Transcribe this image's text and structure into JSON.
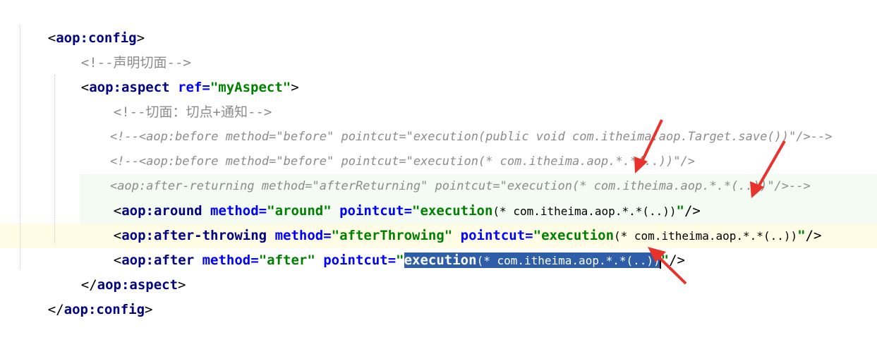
{
  "editor": {
    "lines": {
      "l1": {
        "open": "<",
        "tag": "aop:config",
        "close": ">"
      },
      "l2": {
        "comment": "<!--声明切面-->"
      },
      "l3": {
        "open": "<",
        "tag": "aop:aspect",
        "attr1": " ref=",
        "val1": "\"myAspect\"",
        "close": ">"
      },
      "l4": {
        "comment": "<!--切面：切点+通知-->"
      },
      "l5": {
        "comment": "<!--<aop:before method=\"before\" pointcut=\"execution(public void com.itheima.aop.Target.save())\"/>-->"
      },
      "l6": {
        "comment": "<!--<aop:before method=\"before\" pointcut=\"execution(* com.itheima.aop.*.*(..))\"/>"
      },
      "l7": {
        "comment": "<aop:after-returning method=\"afterReturning\" pointcut=\"execution(* com.itheima.aop.*.*(..))\"/>-->"
      },
      "l8": {
        "open": "<",
        "tag": "aop:around",
        "attr1": " method=",
        "val1": "\"around\"",
        "attr2": " pointcut=",
        "val2a": "\"execution",
        "val2b": "(* com.itheima.aop.*.*(..))",
        "val2c": "\"",
        "close": "/>"
      },
      "l9": {
        "open": "<",
        "tag": "aop:after-throwing",
        "attr1": " method=",
        "val1": "\"afterThrowing\"",
        "attr2": " pointcut=",
        "val2a": "\"execution",
        "val2b": "(* com.itheima.aop.*.*(..))",
        "val2c": "\"",
        "close": "/>"
      },
      "l10": {
        "open": "<",
        "tag": "aop:after",
        "attr1": " method=",
        "val1": "\"after\"",
        "attr2": " pointcut=",
        "val2q": "\"",
        "sel_a": "execution",
        "sel_b": "(* com.itheima.aop.*.*(..))",
        "val2c": "\"",
        "close": "/>"
      },
      "l11": {
        "open": "</",
        "tag": "aop:aspect",
        "close": ">"
      },
      "l12": {
        "open": "</",
        "tag": "aop:config",
        "close": ">"
      }
    }
  },
  "colors": {
    "tag": "#000080",
    "attribute": "#0000ff",
    "value": "#008000",
    "comment": "#8c8c8c",
    "selection": "#2f5ea8",
    "annotation_arrow": "#e8322b"
  },
  "icons": {
    "gutter": "lightbulb-icon"
  }
}
